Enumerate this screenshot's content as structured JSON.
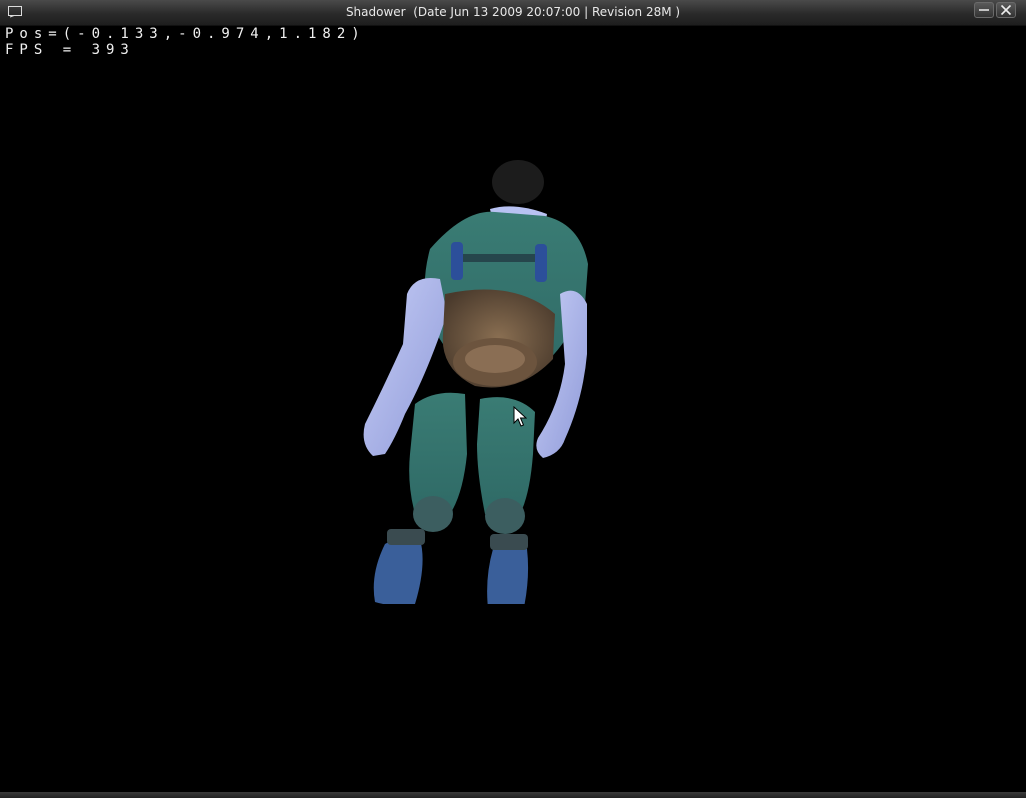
{
  "window": {
    "title": "Shadower  (Date Jun 13 2009 20:07:00 | Revision 28M )",
    "buttons": {
      "minimize_icon": "minimize-icon",
      "close_icon": "close-icon"
    }
  },
  "hud": {
    "position_text": "Pos=(-0.133,-0.974,1.182)",
    "fps_text": "FPS = 393"
  },
  "scene": {
    "background_color": "#000000",
    "subject_icon": "soldier-model",
    "uniform_color": "#3f7f76",
    "skin_color": "#a9b5ee",
    "boot_color": "#3a5f9a"
  }
}
